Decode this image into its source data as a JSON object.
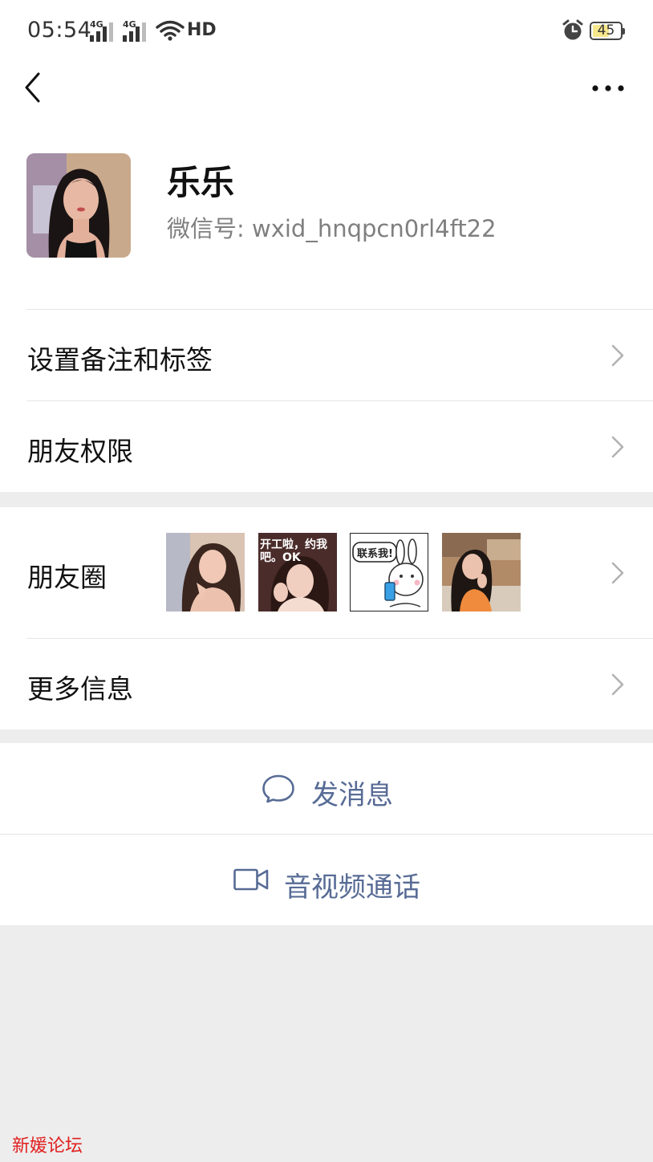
{
  "status_bar": {
    "time": "05:54",
    "signal_1_tag": "4G",
    "signal_2_tag": "4G",
    "network": "HD",
    "battery": "45"
  },
  "nav": {
    "back_icon": "chevron-left-icon",
    "more_icon": "more-horizontal-icon"
  },
  "profile": {
    "name": "乐乐",
    "wechat_id": "微信号: wxid_hnqpcn0rl4ft22"
  },
  "rows": {
    "remark": "设置备注和标签",
    "permissions": "朋友权限",
    "moments": "朋友圈",
    "more_info": "更多信息"
  },
  "moments_thumbs": [
    {
      "caption": ""
    },
    {
      "caption": "开工啦，约我吧。OK"
    },
    {
      "caption": "联系我!"
    },
    {
      "caption": ""
    }
  ],
  "actions": {
    "message": "发消息",
    "message_icon": "chat-bubble-icon",
    "call": "音视频通话",
    "call_icon": "video-camera-icon"
  },
  "watermark": "新媛论坛",
  "colors": {
    "accent": "#576b95",
    "watermark": "#e0201f",
    "background": "#ededed"
  }
}
